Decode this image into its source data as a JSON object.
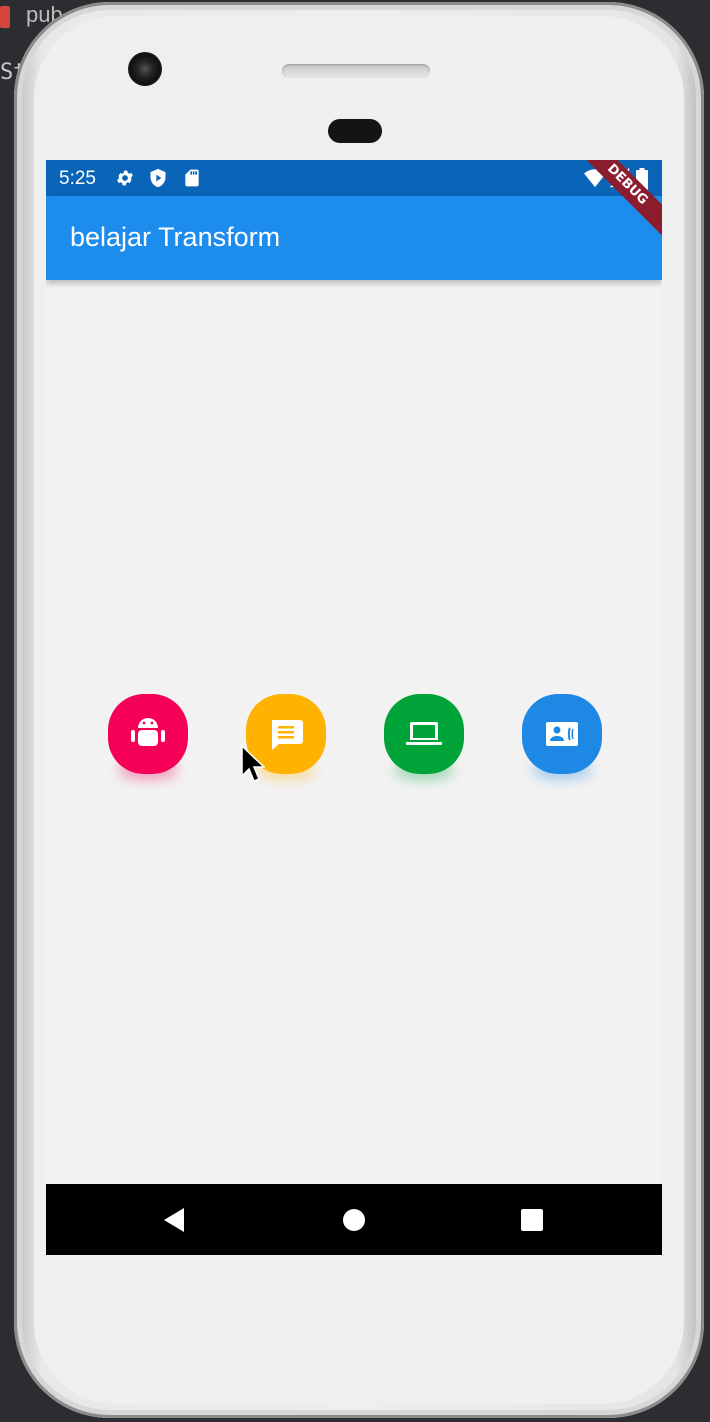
{
  "background": {
    "editor_tab_label": "pub",
    "editor_fragment": "St"
  },
  "status_bar": {
    "time": "5:25",
    "left_icons": [
      "settings-icon",
      "play-protect-icon",
      "sd-card-icon"
    ],
    "right_icons": [
      "wifi-icon",
      "signal-icon",
      "battery-icon"
    ]
  },
  "debug_banner": "DEBUG",
  "app_bar": {
    "title": "belajar Transform"
  },
  "buttons": [
    {
      "name": "android-button",
      "icon": "android-icon",
      "color": "#f50057",
      "light": "#f48fb1"
    },
    {
      "name": "message-button",
      "icon": "message-icon",
      "color": "#ffb300",
      "light": "#ffd54f"
    },
    {
      "name": "laptop-button",
      "icon": "laptop-icon",
      "color": "#00a337",
      "light": "#81c784"
    },
    {
      "name": "contact-phone-button",
      "icon": "contact-phone-icon",
      "color": "#1e88e5",
      "light": "#90caf9"
    }
  ],
  "nav_bar": {
    "buttons": [
      "back-icon",
      "home-icon",
      "recents-icon"
    ]
  }
}
